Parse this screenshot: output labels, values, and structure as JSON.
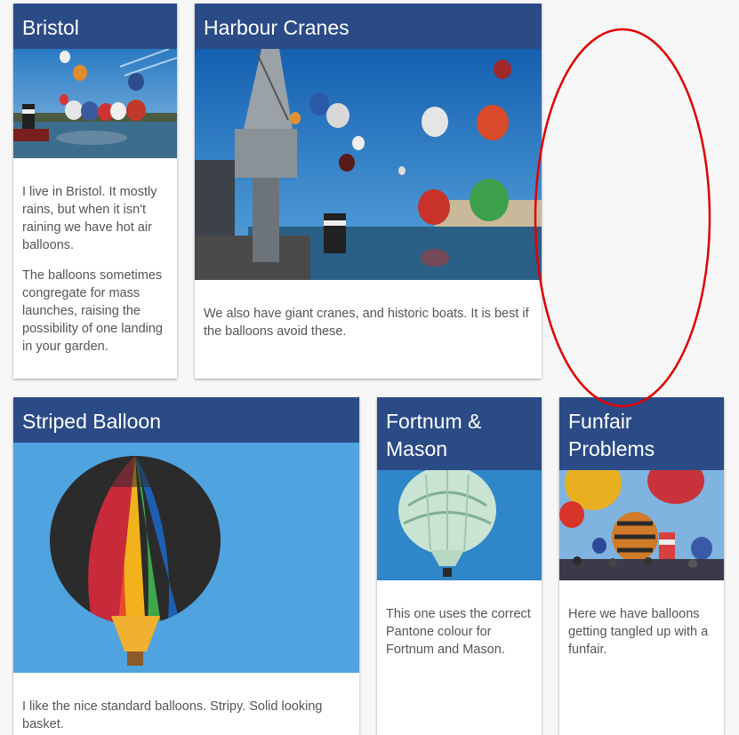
{
  "cards": [
    {
      "title": "Bristol",
      "image": "hot-air-balloons-over-harbour-photo",
      "paragraphs": [
        "I live in Bristol. It mostly rains, but when it isn't raining we have hot air balloons.",
        "The balloons sometimes congregate for mass launches, raising the possibility of one landing in your garden."
      ]
    },
    {
      "title": "Harbour Cranes",
      "image": "harbour-crane-and-balloons-photo",
      "paragraphs": [
        "We also have giant cranes, and historic boats. It is best if the balloons avoid these."
      ]
    },
    {
      "title": "Striped Balloon",
      "image": "striped-hot-air-balloon-photo",
      "paragraphs": [
        "I like the nice standard balloons. Stripy. Solid looking basket."
      ]
    },
    {
      "title": "Fortnum & Mason",
      "image": "fortnum-mason-balloon-photo",
      "paragraphs": [
        "This one uses the correct Pantone colour for Fortnum and Mason."
      ]
    },
    {
      "title": "Funfair Problems",
      "image": "balloons-at-funfair-photo",
      "paragraphs": [
        "Here we have balloons getting tangled up with a funfair."
      ]
    }
  ],
  "colors": {
    "header": "#2b4b87",
    "annotation": "#e00000",
    "sky": "#2f7fc4"
  }
}
